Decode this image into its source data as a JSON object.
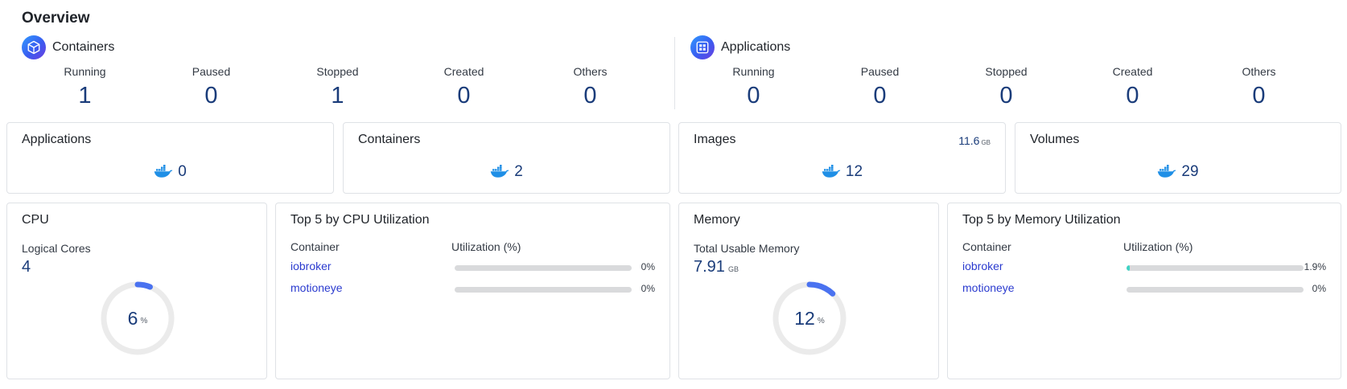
{
  "page": {
    "title": "Overview"
  },
  "containers_summary": {
    "title": "Containers",
    "icon": "cube-icon",
    "stats": [
      {
        "label": "Running",
        "value": "1"
      },
      {
        "label": "Paused",
        "value": "0"
      },
      {
        "label": "Stopped",
        "value": "1"
      },
      {
        "label": "Created",
        "value": "0"
      },
      {
        "label": "Others",
        "value": "0"
      }
    ]
  },
  "applications_summary": {
    "title": "Applications",
    "icon": "app-grid-icon",
    "stats": [
      {
        "label": "Running",
        "value": "0"
      },
      {
        "label": "Paused",
        "value": "0"
      },
      {
        "label": "Stopped",
        "value": "0"
      },
      {
        "label": "Created",
        "value": "0"
      },
      {
        "label": "Others",
        "value": "0"
      }
    ]
  },
  "count_cards": {
    "applications": {
      "title": "Applications",
      "value": "0",
      "icon": "docker-whale-icon"
    },
    "containers": {
      "title": "Containers",
      "value": "2",
      "icon": "docker-whale-icon"
    },
    "images": {
      "title": "Images",
      "value": "12",
      "size": "11.6",
      "size_unit": "GB",
      "icon": "docker-whale-icon"
    },
    "volumes": {
      "title": "Volumes",
      "value": "29",
      "icon": "docker-whale-icon"
    }
  },
  "cpu": {
    "title": "CPU",
    "sub_label": "Logical Cores",
    "cores": "4",
    "usage": "6",
    "usage_unit": "%",
    "usage_fraction": 0.06
  },
  "cpu_top": {
    "title": "Top 5 by CPU Utilization",
    "col_container": "Container",
    "col_util": "Utilization (%)",
    "rows": [
      {
        "name": "iobroker",
        "pct": "0%",
        "fraction": 0
      },
      {
        "name": "motioneye",
        "pct": "0%",
        "fraction": 0
      }
    ]
  },
  "memory": {
    "title": "Memory",
    "sub_label": "Total Usable Memory",
    "total": "7.91",
    "total_unit": "GB",
    "usage": "12",
    "usage_unit": "%",
    "usage_fraction": 0.12
  },
  "memory_top": {
    "title": "Top 5 by Memory Utilization",
    "col_container": "Container",
    "col_util": "Utilization (%)",
    "rows": [
      {
        "name": "iobroker",
        "pct": "1.9%",
        "fraction": 0.019
      },
      {
        "name": "motioneye",
        "pct": "0%",
        "fraction": 0
      }
    ]
  },
  "colors": {
    "accent": "#4a72f0",
    "value_text": "#1a3c7a",
    "link": "#2b3bcf",
    "bar_fill": "#3fd3c4",
    "whale": "#1f8fe6"
  }
}
